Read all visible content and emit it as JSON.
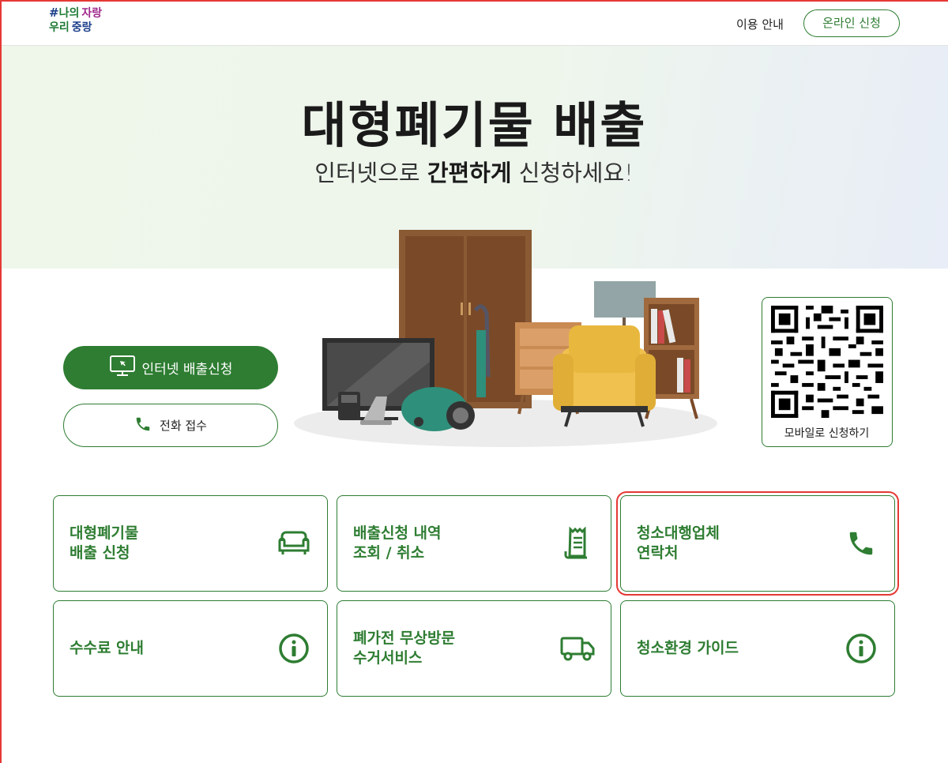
{
  "header": {
    "logo": {
      "hash": "#",
      "line1_a": "나의",
      "line1_b": "자랑",
      "line2_a": "우리",
      "line2_b": "중랑"
    },
    "nav_guide": "이용 안내",
    "nav_apply": "온라인 신청"
  },
  "hero": {
    "title": "대형폐기물 배출",
    "subtitle_pre": "인터넷으로 ",
    "subtitle_bold": "간편하게",
    "subtitle_post": " 신청하세요!"
  },
  "actions": {
    "internet_label": "인터넷 배출신청",
    "phone_label": "전화 접수"
  },
  "qr": {
    "label": "모바일로 신청하기"
  },
  "cards": [
    {
      "label": "대형폐기물\n배출 신청",
      "icon": "sofa-icon"
    },
    {
      "label": "배출신청 내역\n조회 / 취소",
      "icon": "receipt-icon"
    },
    {
      "label": "청소대행업체\n연락처",
      "icon": "phone-icon"
    },
    {
      "label": "수수료 안내",
      "icon": "info-icon"
    },
    {
      "label": "폐가전 무상방문\n수거서비스",
      "icon": "truck-icon"
    },
    {
      "label": "청소환경 가이드",
      "icon": "info-icon"
    }
  ],
  "colors": {
    "brand_green": "#2e7d32",
    "highlight_red": "#e53935"
  }
}
